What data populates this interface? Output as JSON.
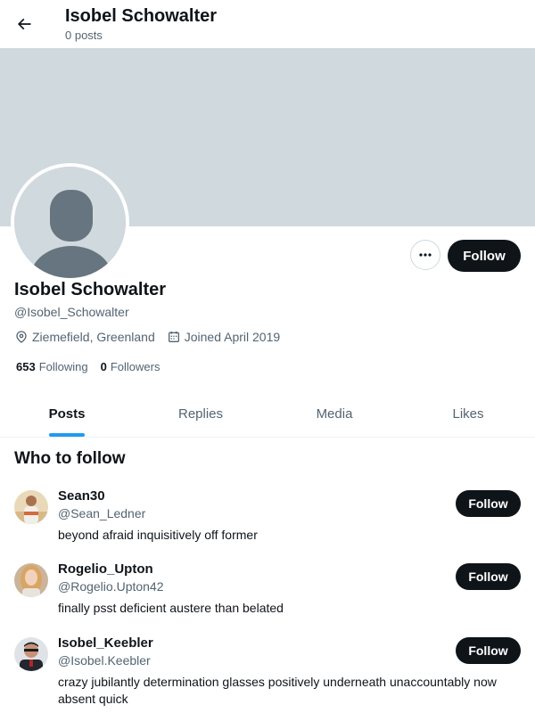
{
  "header": {
    "name": "Isobel Schowalter",
    "post_count": "0 posts"
  },
  "profile": {
    "name": "Isobel Schowalter",
    "handle": "@Isobel_Schowalter",
    "location": "Ziemefield, Greenland",
    "joined": "Joined April 2019",
    "following_count": "653",
    "following_label": "Following",
    "followers_count": "0",
    "followers_label": "Followers",
    "follow_label": "Follow",
    "banner_color": "#cfd9de"
  },
  "tabs": [
    {
      "label": "Posts",
      "active": true
    },
    {
      "label": "Replies",
      "active": false
    },
    {
      "label": "Media",
      "active": false
    },
    {
      "label": "Likes",
      "active": false
    }
  ],
  "who_to_follow": {
    "title": "Who to follow",
    "items": [
      {
        "name": "Sean30",
        "handle": "@Sean_Ledner",
        "bio": "beyond afraid inquisitively off former",
        "follow_label": "Follow"
      },
      {
        "name": "Rogelio_Upton",
        "handle": "@Rogelio.Upton42",
        "bio": "finally psst deficient austere than belated",
        "follow_label": "Follow"
      },
      {
        "name": "Isobel_Keebler",
        "handle": "@Isobel.Keebler",
        "bio": "crazy jubilantly determination glasses positively underneath unaccountably now absent quick",
        "follow_label": "Follow"
      }
    ]
  },
  "colors": {
    "accent": "#1d9bf0",
    "button_dark": "#0f1419",
    "secondary_text": "#536471"
  }
}
